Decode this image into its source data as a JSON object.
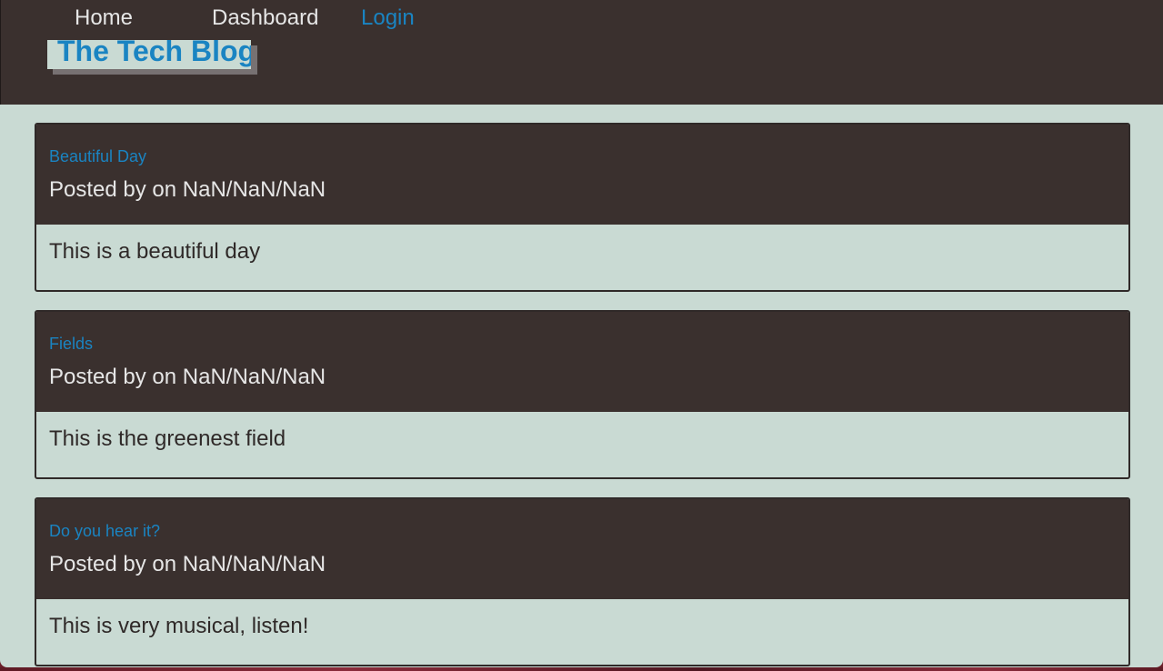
{
  "nav": {
    "home_label": "Home",
    "dashboard_label": "Dashboard",
    "login_label": "Login"
  },
  "site": {
    "title": "The Tech Blog"
  },
  "posts": [
    {
      "title": "Beautiful Day",
      "meta": "Posted by on NaN/NaN/NaN",
      "content": "This is a beautiful day"
    },
    {
      "title": "Fields",
      "meta": "Posted by on NaN/NaN/NaN",
      "content": "This is the greenest field"
    },
    {
      "title": "Do you hear it?",
      "meta": "Posted by on NaN/NaN/NaN",
      "content": "This is very musical, listen!"
    }
  ],
  "colors": {
    "header_bg": "#3a302e",
    "page_bg": "#c9dad3",
    "link": "#1a84c2",
    "text_light": "#e6e6e6",
    "text_dark": "#2f2928"
  }
}
